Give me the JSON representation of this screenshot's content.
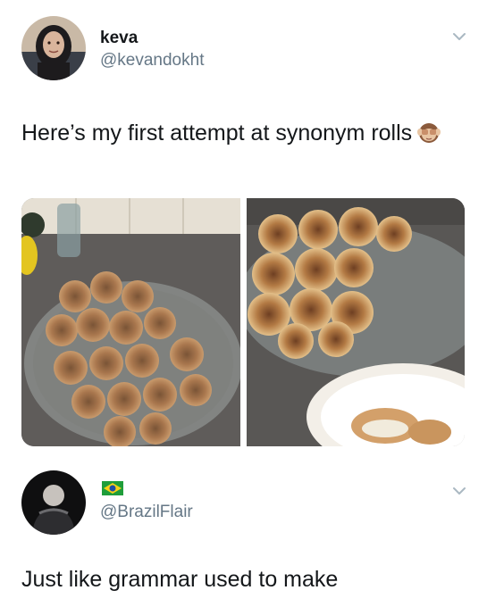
{
  "tweet1": {
    "display_name": "keva",
    "handle": "@kevandokht",
    "text": "Here’s my first attempt at synonym rolls",
    "emoji": "see-no-evil-monkey"
  },
  "tweet2": {
    "flag_emoji": "brazil-flag",
    "handle": "@BrazilFlair",
    "text": "Just like grammar used to make"
  }
}
